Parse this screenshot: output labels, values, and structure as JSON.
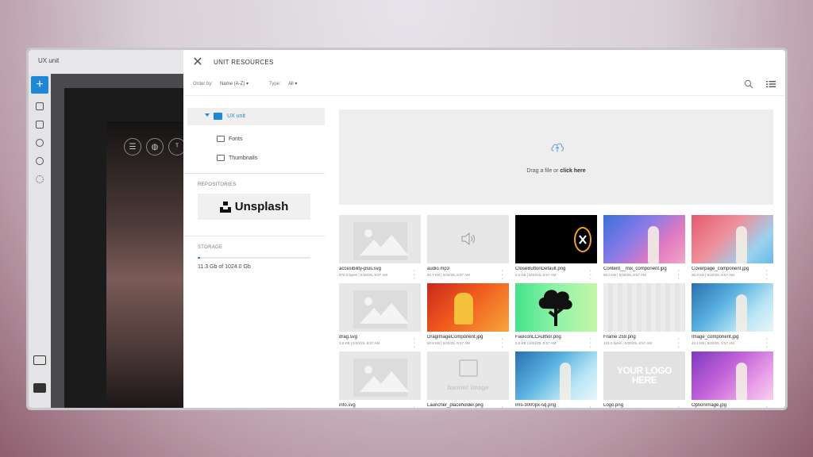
{
  "background_app": {
    "title": "UX unit",
    "add_label": "+"
  },
  "panel": {
    "title": "UNIT RESOURCES",
    "close_label": "✕",
    "order_by_label": "Order by:",
    "order_by_value": "Name (A-Z) ▾",
    "type_label": "Type:",
    "type_value": "All ▾"
  },
  "sidebar": {
    "tree_root": "UX unit",
    "children": [
      "Fonts",
      "Thumbnails"
    ],
    "repositories_label": "REPOSITORIES",
    "unsplash_label": "Unsplash",
    "storage_label": "STORAGE",
    "storage_text": "11.3 Gb of 1024.0 Gb",
    "storage_fraction": 0.011
  },
  "dropzone": {
    "text": "Drag a file or ",
    "link": "click here"
  },
  "files": [
    {
      "name": "accesibility-plus.svg",
      "meta": "875.0 bytes | 5/20/25, 8:57 AM",
      "thumb": "placeholder"
    },
    {
      "name": "audio.mp3",
      "meta": "94.7 KB | 5/20/25, 8:57 AM",
      "thumb": "audio"
    },
    {
      "name": "CloseButtonDefault.png",
      "meta": "2.2 KB | 5/20/25, 8:57 AM",
      "thumb": "close"
    },
    {
      "name": "Content__mix_component.jpg",
      "meta": "56.0 KB | 5/20/25, 8:57 AM",
      "thumb": "waves-blue"
    },
    {
      "name": "Coverpage_component.jpg",
      "meta": "35.9 KB | 5/20/25, 8:57 AM",
      "thumb": "waves-pink"
    },
    {
      "name": "drag.svg",
      "meta": "1.0 KB | 5/20/25, 8:57 AM",
      "thumb": "placeholder"
    },
    {
      "name": "DragImageComponent.jpg",
      "meta": "60.8 KB | 5/20/25, 8:57 AM",
      "thumb": "orange"
    },
    {
      "name": "FaviconLCAuthor.png",
      "meta": "3.8 KB | 5/20/25, 8:57 AM",
      "thumb": "tree"
    },
    {
      "name": "Frame 259.png",
      "meta": "133.0 bytes | 5/20/25, 8:57 AM",
      "thumb": "blank"
    },
    {
      "name": "Image_component.jpg",
      "meta": "40.4 KB | 5/20/25, 8:57 AM",
      "thumb": "waves-cyan"
    },
    {
      "name": "info.svg",
      "meta": "",
      "thumb": "placeholder"
    },
    {
      "name": "Launcher_placeholder.png",
      "meta": "",
      "thumb": "banner",
      "label": "banner image"
    },
    {
      "name": "lms-3000px-sq.png",
      "meta": "",
      "thumb": "waves-cyan"
    },
    {
      "name": "Logo.png",
      "meta": "",
      "thumb": "logo",
      "label": "YOUR LOGO HERE"
    },
    {
      "name": "OptionImage.jpg",
      "meta": "",
      "thumb": "waves-purple"
    }
  ],
  "colors": {
    "accent": "#1e88d6",
    "background_app": "#3b3b3e"
  }
}
